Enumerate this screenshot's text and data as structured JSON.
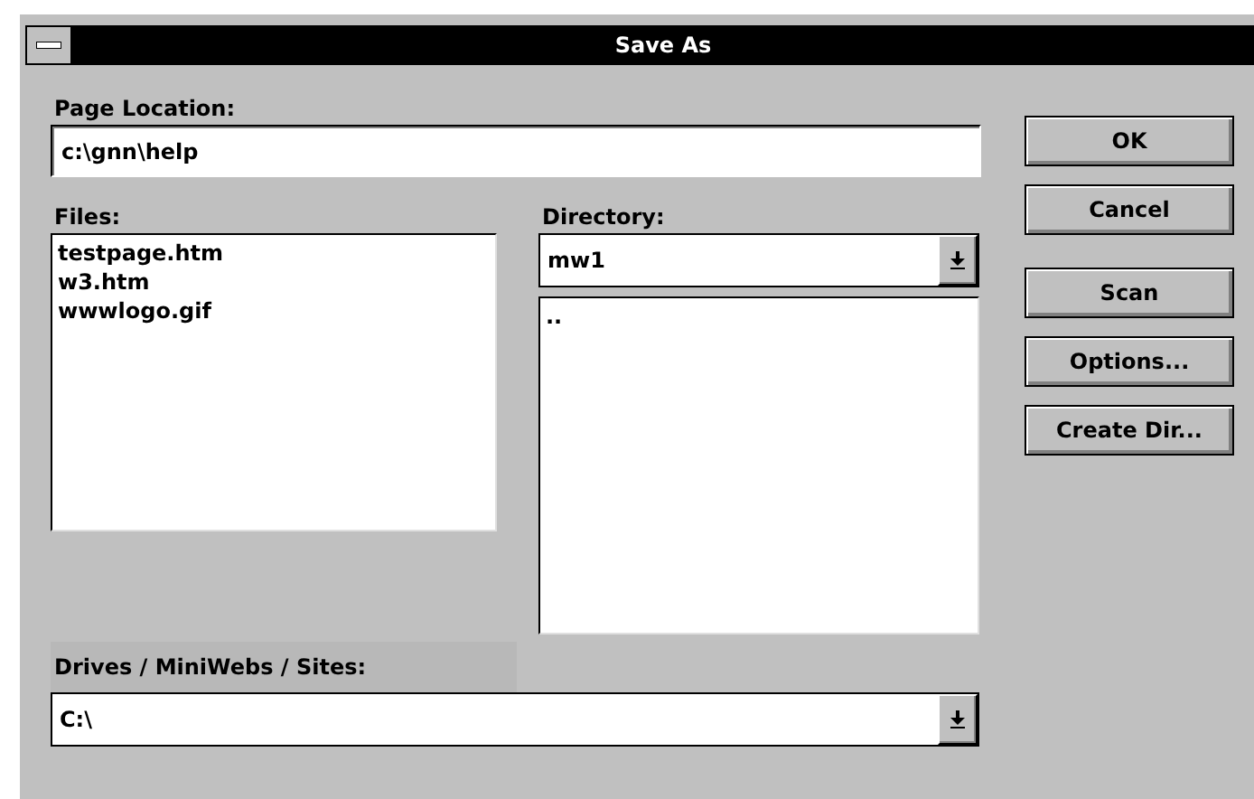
{
  "window": {
    "title": "Save As"
  },
  "page_location": {
    "label": "Page Location:",
    "value": "c:\\gnn\\help"
  },
  "files": {
    "label": "Files:",
    "items": [
      {
        "name": "testpage.htm",
        "selected": false
      },
      {
        "name": "w3.htm",
        "selected": false
      },
      {
        "name": "wwwlogo.gif",
        "selected": false
      }
    ]
  },
  "directory": {
    "label": "Directory:",
    "value": "mw1",
    "items": [
      {
        "name": "..",
        "selected": false
      }
    ]
  },
  "drives": {
    "label": "Drives / MiniWebs / Sites:",
    "value": "C:\\"
  },
  "buttons": [
    "OK",
    "Cancel",
    "Scan",
    "Options...",
    "Create Dir..."
  ]
}
